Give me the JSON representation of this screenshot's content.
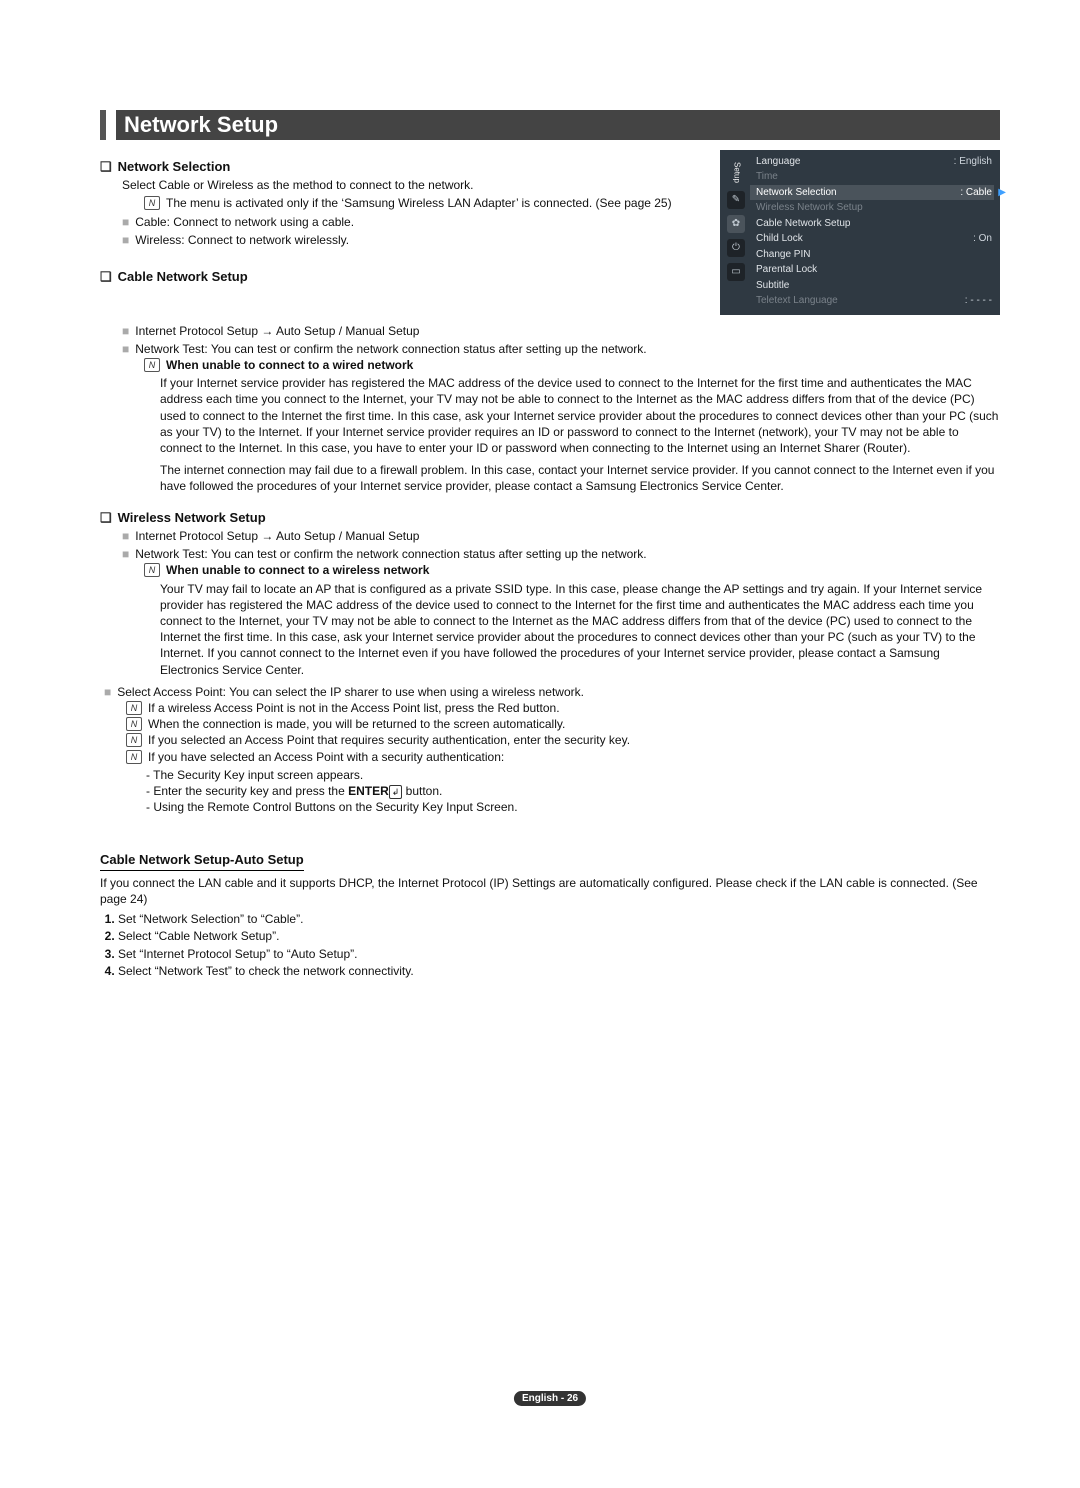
{
  "title": "Network Setup",
  "footer": "English - 26",
  "osd": {
    "side_label": "Setup",
    "rows": [
      {
        "label": "Language",
        "val": ": English",
        "cls": ""
      },
      {
        "label": "Time",
        "val": "",
        "cls": "dim"
      },
      {
        "label": "Network Selection",
        "val": ": Cable",
        "cls": "sel"
      },
      {
        "label": "Wireless Network Setup",
        "val": "",
        "cls": "dim"
      },
      {
        "label": "Cable Network Setup",
        "val": "",
        "cls": ""
      },
      {
        "label": "Child Lock",
        "val": ": On",
        "cls": ""
      },
      {
        "label": "Change PIN",
        "val": "",
        "cls": ""
      },
      {
        "label": "Parental Lock",
        "val": "",
        "cls": ""
      },
      {
        "label": "Subtitle",
        "val": "",
        "cls": ""
      },
      {
        "label": "Teletext Language",
        "val": ": - - - -",
        "cls": "dim"
      }
    ],
    "tab_icons": [
      "brush",
      "gear",
      "plug",
      "speaker"
    ]
  },
  "s1": {
    "head": "Network Selection",
    "intro": "Select Cable or Wireless as the method to connect to the network.",
    "note": "The menu is activated only if the ‘Samsung Wireless LAN Adapter’ is connected. (See page 25)",
    "opt1": "Cable: Connect to network using a cable.",
    "opt2": "Wireless: Connect to network wirelessly."
  },
  "s2": {
    "head": "Cable Network Setup",
    "b1": "Internet Protocol Setup → Auto Setup / Manual Setup",
    "b2": "Network Test: You can test or confirm the network connection status after setting up the network.",
    "note_head": "When unable to connect to a wired network",
    "p1": "If your Internet service provider has registered the MAC address of the device used to connect to the Internet for the first time and authenticates the MAC address each time you connect to the Internet, your TV may not be able to connect to the Internet as the MAC address differs from that of the device (PC) used to connect to the Internet the first time. In this case, ask your Internet service provider about the procedures to connect devices other than your PC (such as your TV) to the Internet. If your Internet service provider requires an ID or password to connect to the Internet (network), your TV may not be able to connect to the Internet. In this case, you have to enter your ID or password when connecting to the Internet using an Internet Sharer (Router).",
    "p2": "The internet connection may fail due to a firewall problem. In this case, contact your Internet service provider. If you cannot connect to the Internet even if you have followed the procedures of your Internet service provider, please contact a Samsung Electronics Service Center."
  },
  "s3": {
    "head": "Wireless Network Setup",
    "b1": "Internet Protocol Setup → Auto Setup / Manual Setup",
    "b2": "Network Test: You can test or confirm the network connection status after setting up the network.",
    "note_head": "When unable to connect to a wireless network",
    "p1": "Your TV may fail to locate an AP that is configured as a private SSID type. In this case, please change the AP settings and try again. If your Internet service provider has registered the MAC address of the device used to connect to the Internet for the first time and authenticates the MAC address each time you connect to the Internet, your TV may not be able to connect to the Internet as the MAC address differs from that of the device (PC) used to connect to the Internet the first time. In this case, ask your Internet service provider about the procedures to connect devices other than your PC (such as your TV) to the Internet. If you cannot connect to the Internet even if you have followed the procedures of your Internet service provider, please contact a Samsung Electronics Service Center.",
    "sap": "Select Access Point: You can select the IP sharer to use when using a wireless network.",
    "n1": "If a wireless Access Point is not in the Access Point list, press the Red button.",
    "n2": "When the connection is made, you will be returned to the screen automatically.",
    "n3": "If you selected an Access Point that requires security authentication, enter the security key.",
    "n4": "If you have selected an Access Point with a security authentication:",
    "d1": "The Security Key input screen appears.",
    "d2a": "Enter the security key and press the ",
    "d2b": "ENTER",
    "d2c": " button.",
    "d3": "Using the Remote Control Buttons on the Security Key Input Screen."
  },
  "s4": {
    "head": "Cable Network Setup-Auto Setup",
    "intro": "If you connect the LAN cable and it supports DHCP, the Internet Protocol (IP) Settings are automatically configured. Please check if the LAN cable is connected. (See page 24)",
    "step1": "Set “Network Selection” to “Cable”.",
    "step2": "Select “Cable Network Setup”.",
    "step3": "Set “Internet Protocol Setup” to “Auto Setup”.",
    "step4": "Select “Network Test” to check the network connectivity."
  }
}
